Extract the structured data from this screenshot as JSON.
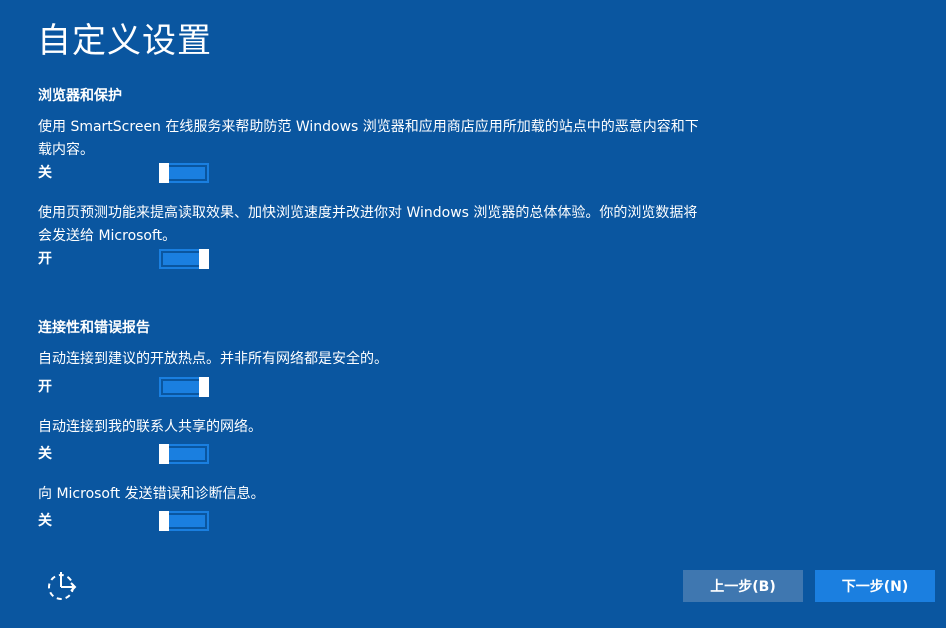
{
  "page": {
    "title": "自定义设置"
  },
  "browser_section": {
    "title": "浏览器和保护",
    "items": [
      {
        "description": "使用 SmartScreen 在线服务来帮助防范 Windows 浏览器和应用商店应用所加载的站点中的恶意内容和下载内容。",
        "state_label": "关",
        "on": false
      },
      {
        "description": "使用页预测功能来提高读取效果、加快浏览速度并改进你对 Windows 浏览器的总体体验。你的浏览数据将会发送给 Microsoft。",
        "state_label": "开",
        "on": true
      }
    ]
  },
  "connectivity_section": {
    "title": "连接性和错误报告",
    "items": [
      {
        "description": "自动连接到建议的开放热点。并非所有网络都是安全的。",
        "state_label": "开",
        "on": true
      },
      {
        "description": "自动连接到我的联系人共享的网络。",
        "state_label": "关",
        "on": false
      },
      {
        "description": "向 Microsoft 发送错误和诊断信息。",
        "state_label": "关",
        "on": false
      }
    ]
  },
  "footer": {
    "ease_of_access_icon": "ease-of-access-icon",
    "back_label": "上一步(B)",
    "next_label": "下一步(N)"
  },
  "colors": {
    "background": "#0a56a0",
    "toggle_accent": "#1a7fe0",
    "back_button": "#3f77b0",
    "next_button": "#1b7fe0"
  }
}
